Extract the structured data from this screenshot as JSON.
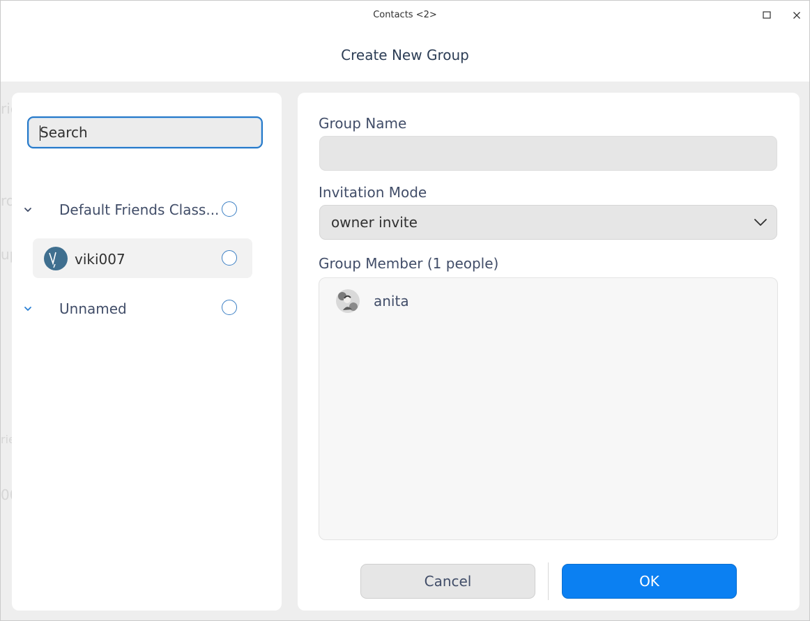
{
  "window": {
    "title": "Contacts <2>",
    "maximize_icon": "maximize-icon",
    "close_icon": "close-icon"
  },
  "dialog": {
    "title": "Create New Group"
  },
  "left_panel": {
    "search": {
      "placeholder": "Search",
      "value": ""
    },
    "groups": [
      {
        "label": "Default Friends Class...",
        "expanded": true,
        "contacts": [
          {
            "name": "viki007",
            "avatar_initial": "V"
          }
        ]
      },
      {
        "label": "Unnamed",
        "expanded": true,
        "contacts": []
      }
    ]
  },
  "right_panel": {
    "group_name_label": "Group Name",
    "group_name_value": "",
    "invitation_mode_label": "Invitation Mode",
    "invitation_mode_value": "owner invite",
    "group_member_label": "Group Member (1 people)",
    "members": [
      {
        "name": "anita"
      }
    ]
  },
  "buttons": {
    "cancel": "Cancel",
    "ok": "OK"
  },
  "colors": {
    "accent": "#0b80f2",
    "radio_border": "#3b7fc4",
    "focus_border": "#2277c8",
    "panel_bg": "#ffffff",
    "window_bg": "#eeeeee"
  }
}
